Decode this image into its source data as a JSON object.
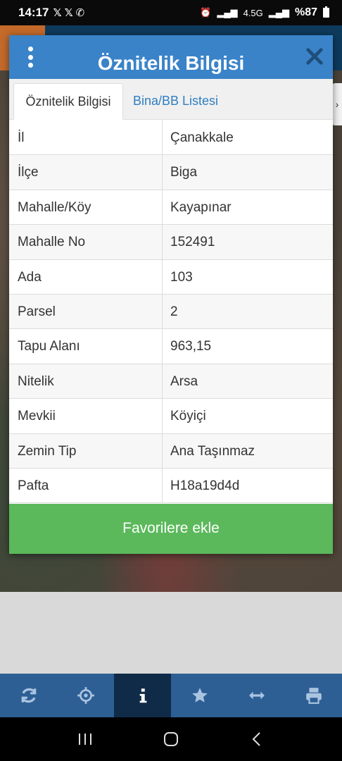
{
  "status_bar": {
    "time": "14:17",
    "notification_icons": [
      "x-icon",
      "x-icon",
      "whatsapp-icon"
    ],
    "network": "4.5G",
    "battery": "%87"
  },
  "dialog": {
    "title": "Öznitelik Bilgisi",
    "tabs": [
      {
        "label": "Öznitelik Bilgisi",
        "active": true
      },
      {
        "label": "Bina/BB Listesi",
        "active": false
      }
    ],
    "rows": [
      {
        "key": "İl",
        "value": "Çanakkale"
      },
      {
        "key": "İlçe",
        "value": "Biga"
      },
      {
        "key": "Mahalle/Köy",
        "value": "Kayapınar"
      },
      {
        "key": "Mahalle No",
        "value": "152491"
      },
      {
        "key": "Ada",
        "value": "103"
      },
      {
        "key": "Parsel",
        "value": "2"
      },
      {
        "key": "Tapu Alanı",
        "value": "963,15"
      },
      {
        "key": "Nitelik",
        "value": "Arsa"
      },
      {
        "key": "Mevkii",
        "value": "Köyiçi"
      },
      {
        "key": "Zemin Tip",
        "value": "Ana Taşınmaz"
      },
      {
        "key": "Pafta",
        "value": "H18a19d4d"
      }
    ],
    "favorite_button": "Favorilere ekle"
  },
  "toolbar": {
    "tools": [
      "refresh-icon",
      "locate-icon",
      "info-icon",
      "star-icon",
      "measure-icon",
      "print-icon"
    ],
    "active": "info-icon"
  },
  "colors": {
    "header": "#3a83c8",
    "favorite": "#5bb95b",
    "toolbar": "#2d5f95",
    "toolbar_active": "#102b48",
    "tab_link": "#2f7ec1"
  }
}
